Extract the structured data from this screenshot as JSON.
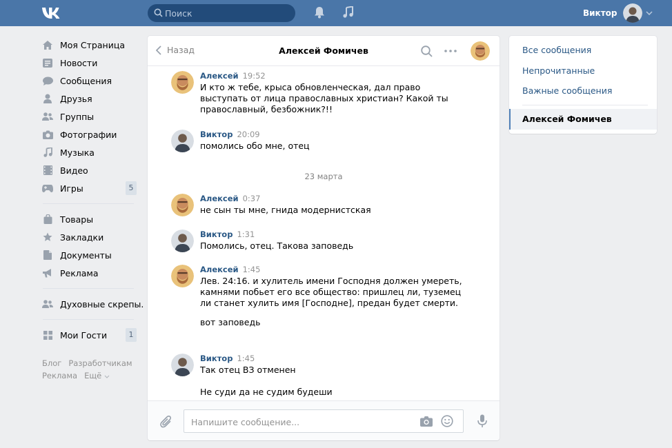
{
  "header": {
    "logo_text": "VK",
    "search_placeholder": "Поиск",
    "user_name": "Виктор",
    "brand_color": "#4a76a8"
  },
  "leftnav": {
    "items": [
      {
        "label": "Моя Страница",
        "icon": "home-icon"
      },
      {
        "label": "Новости",
        "icon": "news-icon"
      },
      {
        "label": "Сообщения",
        "icon": "messages-icon"
      },
      {
        "label": "Друзья",
        "icon": "friends-icon"
      },
      {
        "label": "Группы",
        "icon": "groups-icon"
      },
      {
        "label": "Фотографии",
        "icon": "camera-icon"
      },
      {
        "label": "Музыка",
        "icon": "music-icon"
      },
      {
        "label": "Видео",
        "icon": "video-icon"
      },
      {
        "label": "Игры",
        "icon": "gamepad-icon",
        "badge": "5"
      }
    ],
    "items2": [
      {
        "label": "Товары",
        "icon": "bag-icon"
      },
      {
        "label": "Закладки",
        "icon": "star-icon"
      },
      {
        "label": "Документы",
        "icon": "document-icon"
      },
      {
        "label": "Реклама",
        "icon": "megaphone-icon"
      }
    ],
    "items3": [
      {
        "label": "Духовные скрепы.",
        "icon": "group-icon"
      }
    ],
    "items4": [
      {
        "label": "Мои Гости",
        "icon": "apps-icon",
        "badge": "1"
      }
    ],
    "footer": {
      "blog": "Блог",
      "developers": "Разработчикам",
      "ads": "Реклама",
      "more": "Ещё"
    }
  },
  "chat": {
    "back_label": "Назад",
    "title": "Алексей Фомичев",
    "composer_placeholder": "Напишите сообщение...",
    "messages": [
      {
        "author": "Алексей",
        "time": "19:52",
        "who": "alexey",
        "text": [
          "И кто ж тебе, крыса обновленческая, дал право выступать от лица православных христиан? Какой ты православный, безбожник?!!"
        ]
      },
      {
        "author": "Виктор",
        "time": "20:09",
        "who": "viktor",
        "text": [
          "помолись обо мне, отец"
        ]
      },
      {
        "author": "Алексей",
        "time": "0:37",
        "who": "alexey",
        "text": [
          "не сын ты мне, гнида модернистская"
        ]
      },
      {
        "author": "Виктор",
        "time": "1:31",
        "who": "viktor",
        "text": [
          "Помолись, отец. Такова заповедь"
        ]
      },
      {
        "author": "Алексей",
        "time": "1:45",
        "who": "alexey",
        "text": [
          "Лев. 24:16. и хулитель имени Господня должен умереть, камнями побьет его все общество: пришлец ли, туземец ли станет хулить имя [Господне], предан будет смерти.",
          "вот заповедь"
        ]
      },
      {
        "author": "Виктор",
        "time": "1:45",
        "who": "viktor",
        "text": [
          "Так отец ВЗ отменен",
          "Не суди да не судим будеши"
        ]
      }
    ],
    "date_separator": "23 марта"
  },
  "rightnav": {
    "all": "Все сообщения",
    "unread": "Непрочитанные",
    "important": "Важные сообщения",
    "active": "Алексей Фомичев"
  }
}
